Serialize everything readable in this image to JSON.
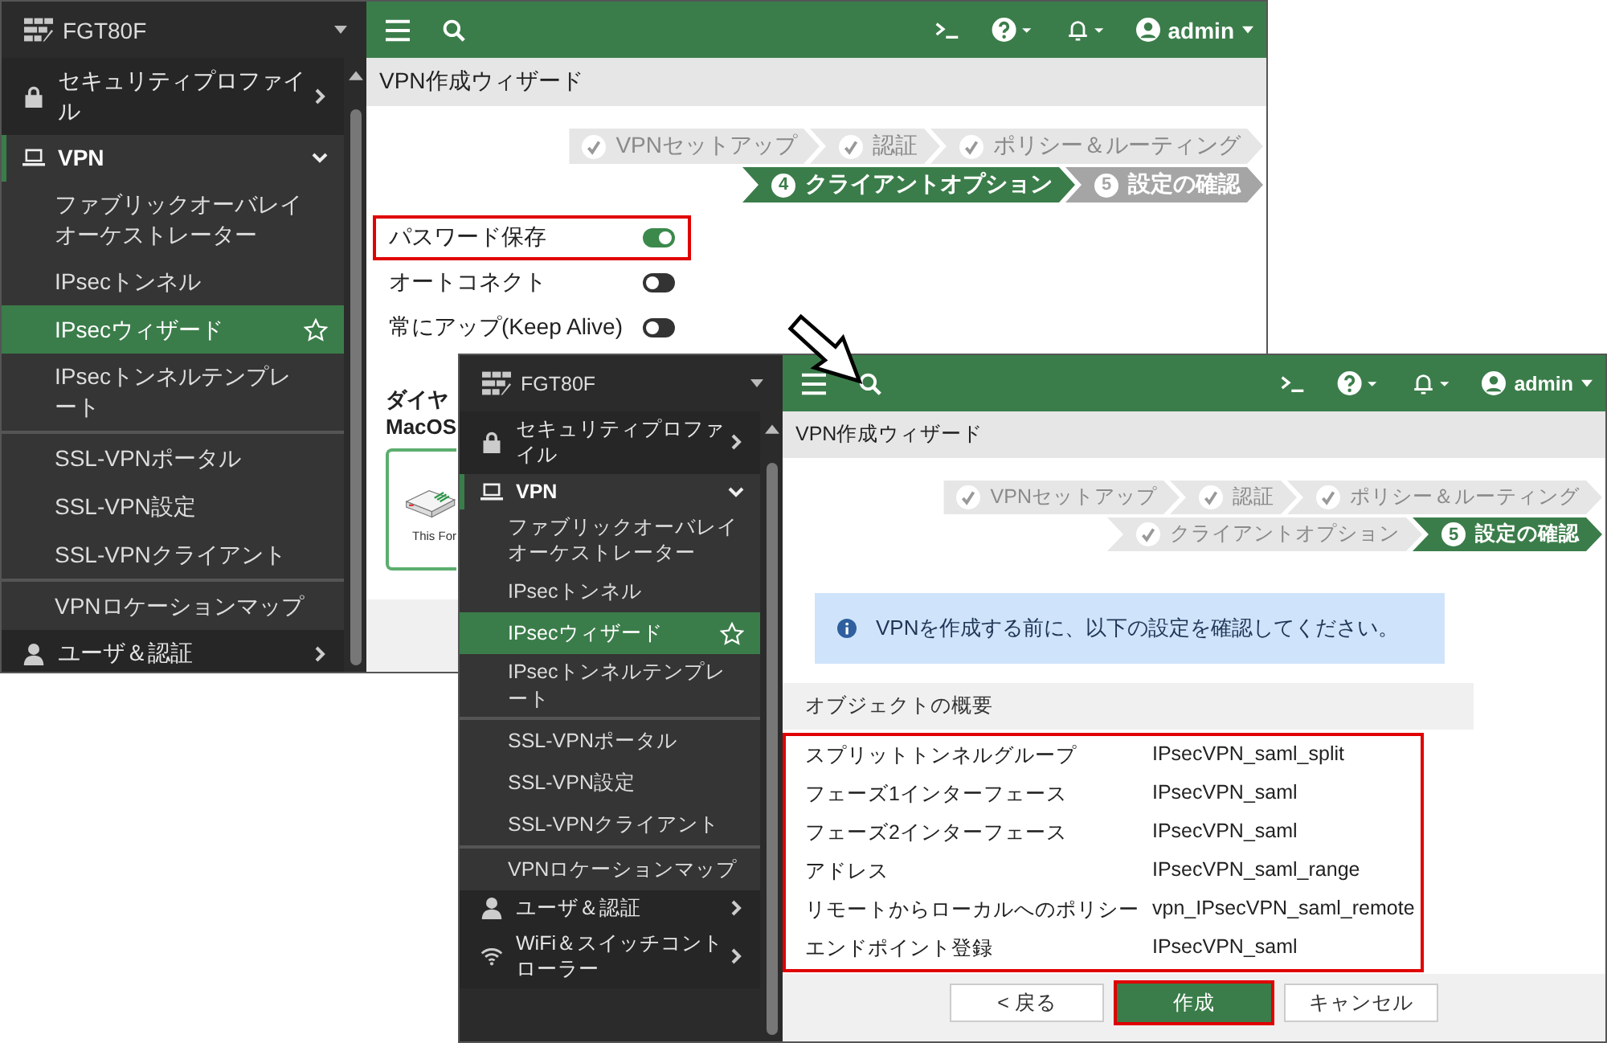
{
  "windows": [
    {
      "device": "FGT80F",
      "user": "admin",
      "page_title": "VPN作成ウィザード",
      "sidebar": [
        {
          "kind": "security",
          "label": "セキュリティプロファイル",
          "expanded": false
        },
        {
          "kind": "vpn",
          "label": "VPN",
          "expanded": true,
          "children": [
            {
              "label": "ファブリックオーバレイオーケストレーター",
              "selected": false,
              "separator_above": false
            },
            {
              "label": "IPsecトンネル",
              "selected": false,
              "separator_above": false
            },
            {
              "label": "IPsecウィザード",
              "selected": true,
              "separator_above": false
            },
            {
              "label": "IPsecトンネルテンプレート",
              "selected": false,
              "separator_above": false
            },
            {
              "label": "SSL-VPNポータル",
              "selected": false,
              "separator_above": true
            },
            {
              "label": "SSL-VPN設定",
              "selected": false,
              "separator_above": false
            },
            {
              "label": "SSL-VPNクライアント",
              "selected": false,
              "separator_above": false
            },
            {
              "label": "VPNロケーションマップ",
              "selected": false,
              "separator_above": true
            }
          ]
        },
        {
          "kind": "user",
          "label": "ユーザ＆認証",
          "expanded": false
        }
      ],
      "steps": [
        [
          {
            "label": "VPNセットアップ",
            "done": true,
            "current": false
          },
          {
            "label": "認証",
            "done": true,
            "current": false
          },
          {
            "label": "ポリシー＆ルーティング",
            "done": true,
            "current": false
          }
        ],
        [
          {
            "label": "クライアントオプション",
            "done": false,
            "current": true,
            "number": "4"
          },
          {
            "label": "設定の確認",
            "done": false,
            "current": false,
            "number": "5"
          }
        ]
      ],
      "toggles": [
        {
          "label": "パスワード保存",
          "on": true,
          "highlighted": true
        },
        {
          "label": "オートコネクト",
          "on": false,
          "highlighted": false
        },
        {
          "label": "常にアップ(Keep Alive)",
          "on": false,
          "highlighted": false
        }
      ],
      "section": {
        "title": "ダイヤ",
        "subtitle": "MacOS",
        "card_caption": "This For"
      }
    },
    {
      "device": "FGT80F",
      "user": "admin",
      "page_title": "VPN作成ウィザード",
      "sidebar": [
        {
          "kind": "security",
          "label": "セキュリティプロファイル",
          "expanded": false
        },
        {
          "kind": "vpn",
          "label": "VPN",
          "expanded": true,
          "children": [
            {
              "label": "ファブリックオーバレイオーケストレーター",
              "selected": false,
              "separator_above": false
            },
            {
              "label": "IPsecトンネル",
              "selected": false,
              "separator_above": false
            },
            {
              "label": "IPsecウィザード",
              "selected": true,
              "separator_above": false
            },
            {
              "label": "IPsecトンネルテンプレート",
              "selected": false,
              "separator_above": false
            },
            {
              "label": "SSL-VPNポータル",
              "selected": false,
              "separator_above": true
            },
            {
              "label": "SSL-VPN設定",
              "selected": false,
              "separator_above": false
            },
            {
              "label": "SSL-VPNクライアント",
              "selected": false,
              "separator_above": false
            },
            {
              "label": "VPNロケーションマップ",
              "selected": false,
              "separator_above": true
            }
          ]
        },
        {
          "kind": "user",
          "label": "ユーザ＆認証",
          "expanded": false
        },
        {
          "kind": "wifi",
          "label": "WiFi＆スイッチコントローラー",
          "expanded": false
        }
      ],
      "steps": [
        [
          {
            "label": "VPNセットアップ",
            "done": true,
            "current": false
          },
          {
            "label": "認証",
            "done": true,
            "current": false
          },
          {
            "label": "ポリシー＆ルーティング",
            "done": true,
            "current": false
          }
        ],
        [
          {
            "label": "クライアントオプション",
            "done": true,
            "current": false
          },
          {
            "label": "設定の確認",
            "done": false,
            "current": true,
            "number": "5"
          }
        ]
      ],
      "info": "VPNを作成する前に、以下の設定を確認してください。",
      "summary": {
        "title": "オブジェクトの概要",
        "highlighted": true,
        "rows": [
          {
            "label": "スプリットトンネルグループ",
            "value": "IPsecVPN_saml_split"
          },
          {
            "label": "フェーズ1インターフェース",
            "value": "IPsecVPN_saml"
          },
          {
            "label": "フェーズ2インターフェース",
            "value": "IPsecVPN_saml"
          },
          {
            "label": "アドレス",
            "value": "IPsecVPN_saml_range"
          },
          {
            "label": "リモートからローカルへのポリシー",
            "value": "vpn_IPsecVPN_saml_remote"
          },
          {
            "label": "エンドポイント登録",
            "value": "IPsecVPN_saml"
          }
        ]
      },
      "buttons": [
        {
          "label": "< 戻る",
          "kind": "back",
          "highlighted": false
        },
        {
          "label": "作成",
          "kind": "primary",
          "highlighted": true
        },
        {
          "label": "キャンセル",
          "kind": "cancel",
          "highlighted": false
        }
      ]
    }
  ]
}
